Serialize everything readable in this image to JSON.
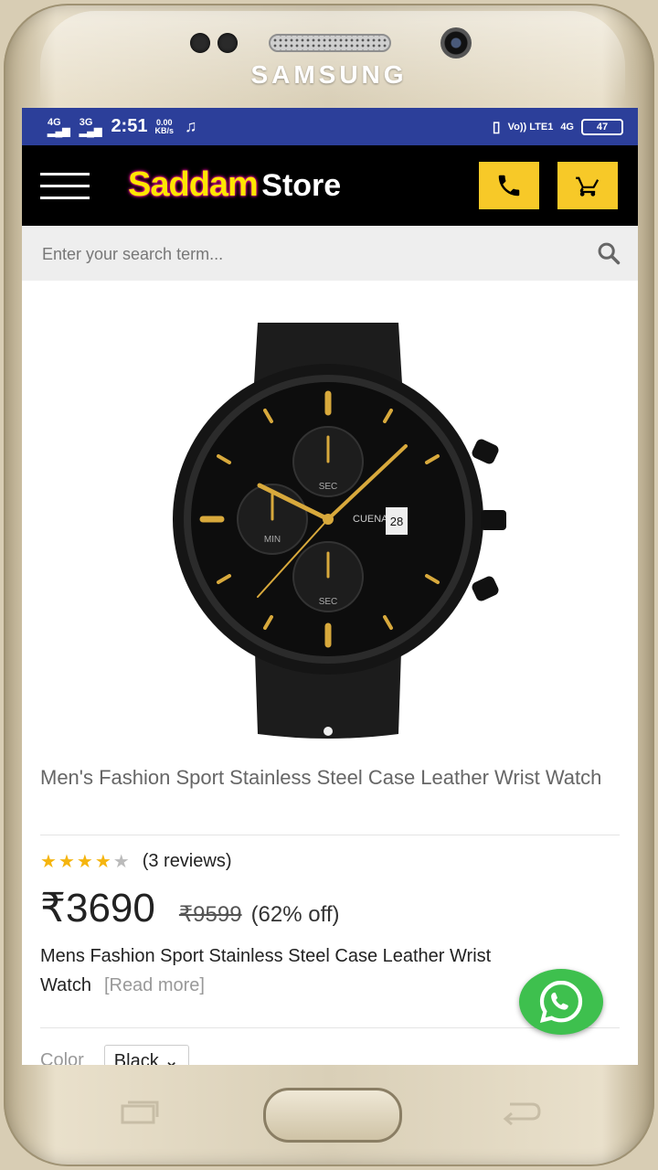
{
  "device": {
    "brand": "SAMSUNG"
  },
  "status_bar": {
    "net1": "4G",
    "net2": "3G",
    "time": "2:51",
    "speed_value": "0.00",
    "speed_unit": "KB/s",
    "volte": "Vo)) LTE1",
    "net3": "4G",
    "battery": "47"
  },
  "header": {
    "logo_part1": "Saddam",
    "logo_part2": "Store",
    "accent_color": "#f7c928"
  },
  "search": {
    "placeholder": "Enter your search term..."
  },
  "product": {
    "title": "Men's Fashion Sport Stainless Steel Case Leather Wrist Watch",
    "rating": 4.5,
    "reviews": "(3 reviews)",
    "price": "₹3690",
    "mrp": "₹9599",
    "discount": "(62% off)",
    "description": "Mens Fashion Sport Stainless Steel Case Leather Wrist Watch",
    "read_more": "[Read more]",
    "color_label": "Color",
    "color_value": "Black",
    "watch_brand": "CUENA",
    "dial_sec": "SEC",
    "dial_min": "MIN",
    "dial_date": "28"
  },
  "icons": [
    "menu-icon",
    "phone-icon",
    "cart-icon",
    "search-icon",
    "star-icon",
    "whatsapp-icon",
    "chevron-down-icon"
  ]
}
